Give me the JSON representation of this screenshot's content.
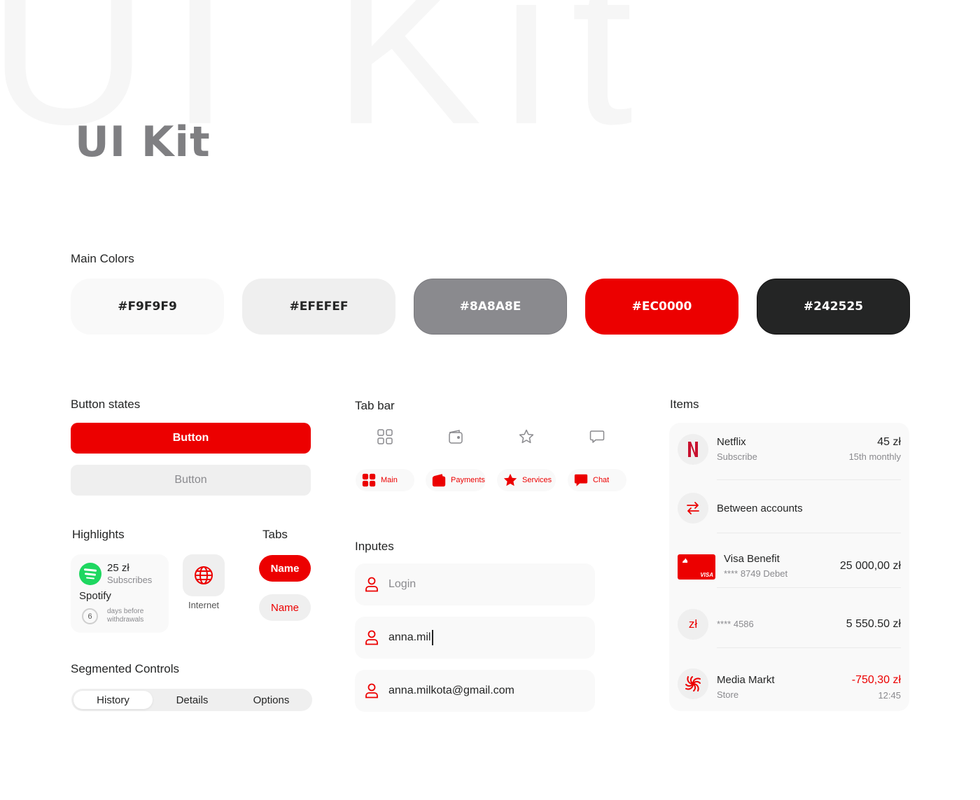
{
  "header": {
    "background_text": "UI Kit",
    "title": "UI Kit"
  },
  "colors": {
    "label": "Main Colors",
    "swatches": [
      {
        "hex": "#F9F9F9",
        "text_color": "#242525"
      },
      {
        "hex": "#EFEFEF",
        "text_color": "#242525"
      },
      {
        "hex": "#8A8A8E",
        "text_color": "#ffffff"
      },
      {
        "hex": "#EC0000",
        "text_color": "#ffffff"
      },
      {
        "hex": "#242525",
        "text_color": "#ffffff"
      }
    ]
  },
  "button_states": {
    "label": "Button states",
    "primary_label": "Button",
    "disabled_label": "Button"
  },
  "highlights": {
    "label": "Highlights",
    "spotify": {
      "amount": "25 zł",
      "subtitle": "Subscribes",
      "name": "Spotify",
      "days": "6",
      "days_label": "days before withdrawals",
      "icon": "spotify-logo-icon"
    },
    "internet": {
      "label": "Internet",
      "icon": "globe-icon"
    }
  },
  "tabs": {
    "label": "Tabs",
    "active": "Name",
    "inactive": "Name"
  },
  "segmented": {
    "label": "Segmented Controls",
    "items": [
      "History",
      "Details",
      "Options"
    ],
    "selected": "History"
  },
  "tab_bar": {
    "label": "Tab bar",
    "outline_icons": [
      "grid-icon",
      "wallet-icon",
      "star-icon",
      "chat-icon"
    ],
    "chips": [
      {
        "label": "Main",
        "icon": "grid-icon"
      },
      {
        "label": "Payments",
        "icon": "wallet-icon"
      },
      {
        "label": "Services",
        "icon": "star-icon"
      },
      {
        "label": "Chat",
        "icon": "chat-icon"
      }
    ]
  },
  "inputs": {
    "label": "Inputes",
    "fields": [
      {
        "placeholder": "Login",
        "value": ""
      },
      {
        "placeholder": "",
        "value": "anna.mil"
      },
      {
        "placeholder": "",
        "value": "anna.milkota@gmail.com"
      }
    ]
  },
  "items": {
    "label": "Items",
    "list": [
      {
        "title": "Netflix",
        "subtitle": "Subscribe",
        "amount": "45 zł",
        "right_sub": "15th monthly",
        "icon": "netflix-logo-icon"
      },
      {
        "title": "Between accounts",
        "subtitle": "",
        "amount": "",
        "right_sub": "",
        "icon": "transfer-arrows-icon"
      },
      {
        "title": "Visa Benefit",
        "subtitle": "**** 8749 Debet",
        "amount": "25 000,00 zł",
        "right_sub": "",
        "icon": "visa-card-icon",
        "card_brand": "VISA"
      },
      {
        "title": "",
        "subtitle": "**** 4586",
        "amount": "5 550.50 zł",
        "right_sub": "",
        "icon": "zloty-icon",
        "icon_text": "zł"
      },
      {
        "title": "Media Markt",
        "subtitle": "Store",
        "amount": "-750,30 zł",
        "right_sub": "12:45",
        "icon": "media-markt-logo-icon"
      }
    ]
  },
  "accent": "#EC0000"
}
